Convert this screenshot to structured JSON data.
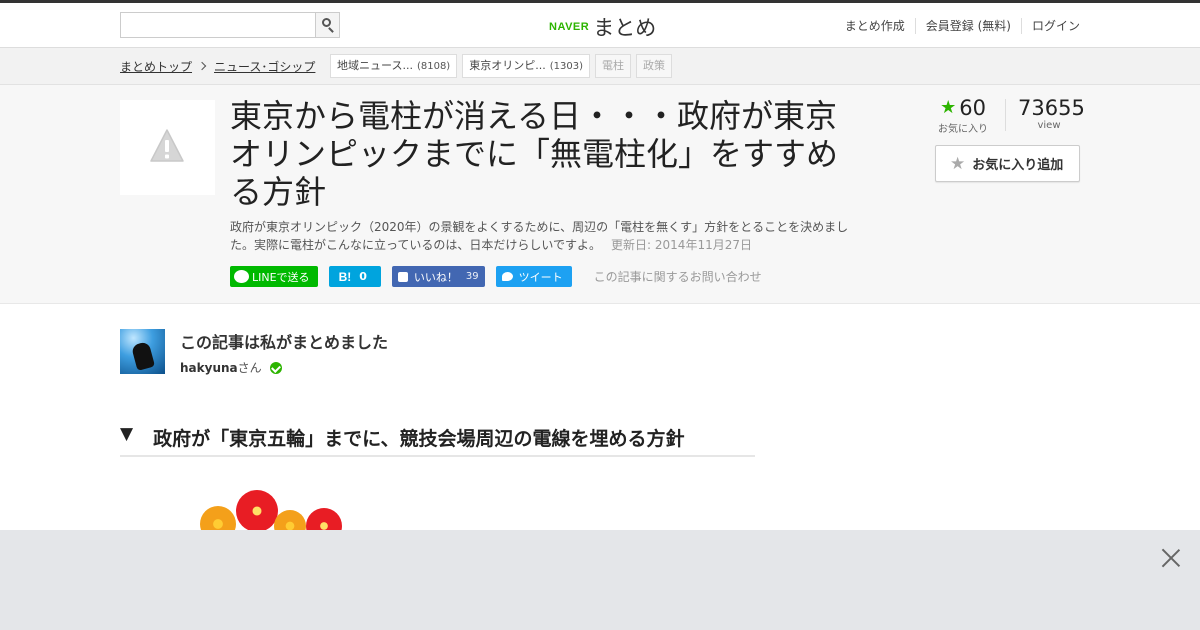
{
  "header": {
    "search": {
      "value": "",
      "placeholder": ""
    },
    "logo": {
      "naver": "NAVER",
      "matome": "まとめ"
    },
    "links": [
      "まとめ作成",
      "会員登録 (無料)",
      "ログイン"
    ]
  },
  "breadcrumb": {
    "items": [
      "まとめトップ",
      "ニュース･ゴシップ"
    ]
  },
  "tags": [
    {
      "label": "地域ニュース...",
      "count": "(8108)"
    },
    {
      "label": "東京オリンピ...",
      "count": "(1303)"
    },
    {
      "label": "電柱",
      "count": ""
    },
    {
      "label": "政策",
      "count": ""
    }
  ],
  "article": {
    "title": "東京から電柱が消える日・・・政府が東京オリンピックまでに「無電柱化」をすすめる方針",
    "description": "政府が東京オリンピック（2020年）の景観をよくするために、周辺の「電柱を無くす」方針をとることを決めました。実際に電柱がこんなに立っているのは、日本だけらしいですよ。",
    "updated": "更新日: 2014年11月27日"
  },
  "share": {
    "line": "LINEで送る",
    "hatena_icon": "B!",
    "hatena_count": "0",
    "facebook": "いいね！",
    "facebook_count": "39",
    "twitter": "ツイート",
    "contact": "この記事に関するお問い合わせ"
  },
  "stats": {
    "favorites": "60",
    "favorites_label": "お気に入り",
    "views": "73655",
    "views_label": "view",
    "add_favorite": "お気に入り追加"
  },
  "author": {
    "heading": "この記事は私がまとめました",
    "name": "hakyuna",
    "suffix": "さん"
  },
  "section": {
    "arrow": "▼",
    "title": "政府が「東京五輪」までに、競技会場周辺の電線を埋める方針"
  },
  "colors": {
    "brand_green": "#2db400",
    "line_green": "#00b900",
    "hatena_blue": "#00a4de",
    "facebook_blue": "#4267b2",
    "twitter_blue": "#1da1f2"
  }
}
